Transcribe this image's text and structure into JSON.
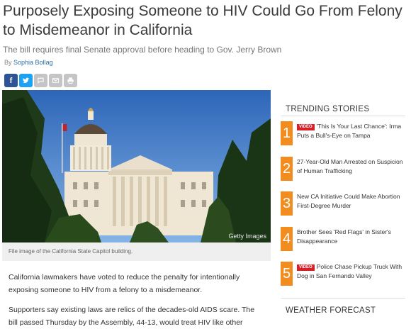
{
  "article": {
    "headline": "Purposely Exposing Someone to HIV Could Go From Felony to Misdemeanor in California",
    "subhead": "The bill requires final Senate approval before heading to Gov. Jerry Brown",
    "by_prefix": "By",
    "author": "Sophia Bollag",
    "photo_credit": "Getty Images",
    "caption": "File image of the California State Capitol building.",
    "paragraph1": "California lawmakers have voted to reduce the penalty for intentionally exposing someone to HIV from a felony to a misdemeanor.",
    "paragraph2": "Supporters say existing laws are relics of the decades-old AIDS scare. The bill passed Thursday by the Assembly, 44-13, would treat HIV like other"
  },
  "share": {
    "icons": [
      "facebook-icon",
      "twitter-icon",
      "comment-icon",
      "email-icon",
      "print-icon"
    ],
    "facebook_glyph": "f"
  },
  "trending": {
    "title": "TRENDING STORIES",
    "badge_label": "VIDEO",
    "accent_color": "#f28c1f",
    "items": [
      {
        "num": "1",
        "video": true,
        "text": "'This Is Your Last Chance': Irma Puts a Bull's-Eye on Tampa"
      },
      {
        "num": "2",
        "video": false,
        "text": "27-Year-Old Man Arrested on Suspicion of Human Trafficking"
      },
      {
        "num": "3",
        "video": false,
        "text": "New CA Initiative Could Make Abortion First-Degree Murder"
      },
      {
        "num": "4",
        "video": false,
        "text": "Brother Sees 'Red Flags' in Sister's Disappearance"
      },
      {
        "num": "5",
        "video": true,
        "text": "Police Chase Pickup Truck With Dog in San Fernando Valley"
      }
    ]
  },
  "weather": {
    "title": "WEATHER FORECAST"
  }
}
